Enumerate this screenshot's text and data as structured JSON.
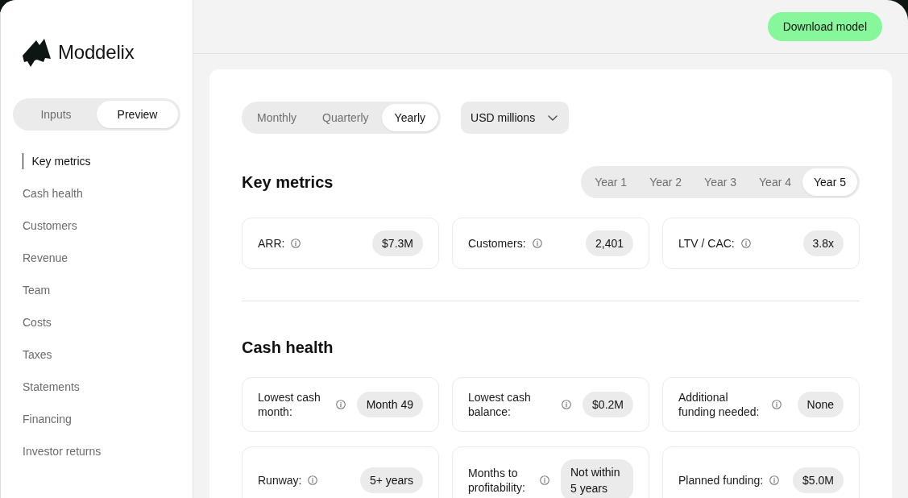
{
  "sidebar": {
    "brand": "Moddelix",
    "mode_tabs": [
      {
        "label": "Inputs",
        "selected": false
      },
      {
        "label": "Preview",
        "selected": true
      }
    ],
    "nav": [
      {
        "label": "Key metrics",
        "selected": true
      },
      {
        "label": "Cash health",
        "selected": false
      },
      {
        "label": "Customers",
        "selected": false
      },
      {
        "label": "Revenue",
        "selected": false
      },
      {
        "label": "Team",
        "selected": false
      },
      {
        "label": "Costs",
        "selected": false
      },
      {
        "label": "Taxes",
        "selected": false
      },
      {
        "label": "Statements",
        "selected": false
      },
      {
        "label": "Financing",
        "selected": false
      },
      {
        "label": "Investor returns",
        "selected": false
      }
    ]
  },
  "header": {
    "action_button": "Download model"
  },
  "report": {
    "period_tabs": [
      {
        "label": "Monthly",
        "selected": false
      },
      {
        "label": "Quarterly",
        "selected": false
      },
      {
        "label": "Yearly",
        "selected": true
      }
    ],
    "currency_select": {
      "value": "USD millions"
    },
    "sections": [
      {
        "title": "Key metrics",
        "year_tabs": [
          {
            "label": "Year 1",
            "selected": false
          },
          {
            "label": "Year 2",
            "selected": false
          },
          {
            "label": "Year 3",
            "selected": false
          },
          {
            "label": "Year 4",
            "selected": false
          },
          {
            "label": "Year 5",
            "selected": true
          }
        ],
        "metrics": [
          {
            "label": "ARR:",
            "value": "$7.3M"
          },
          {
            "label": "Customers:",
            "value": "2,401"
          },
          {
            "label": "LTV / CAC:",
            "value": "3.8x"
          }
        ]
      },
      {
        "title": "Cash health",
        "metrics": [
          {
            "label": "Lowest cash month:",
            "value": "Month 49"
          },
          {
            "label": "Lowest cash balance:",
            "value": "$0.2M"
          },
          {
            "label": "Additional funding needed:",
            "value": "None"
          },
          {
            "label": "Runway:",
            "value": "5+ years"
          },
          {
            "label": "Months to profitability:",
            "value": "Not within 5 years"
          },
          {
            "label": "Planned funding:",
            "value": "$5.0M"
          }
        ]
      }
    ]
  }
}
